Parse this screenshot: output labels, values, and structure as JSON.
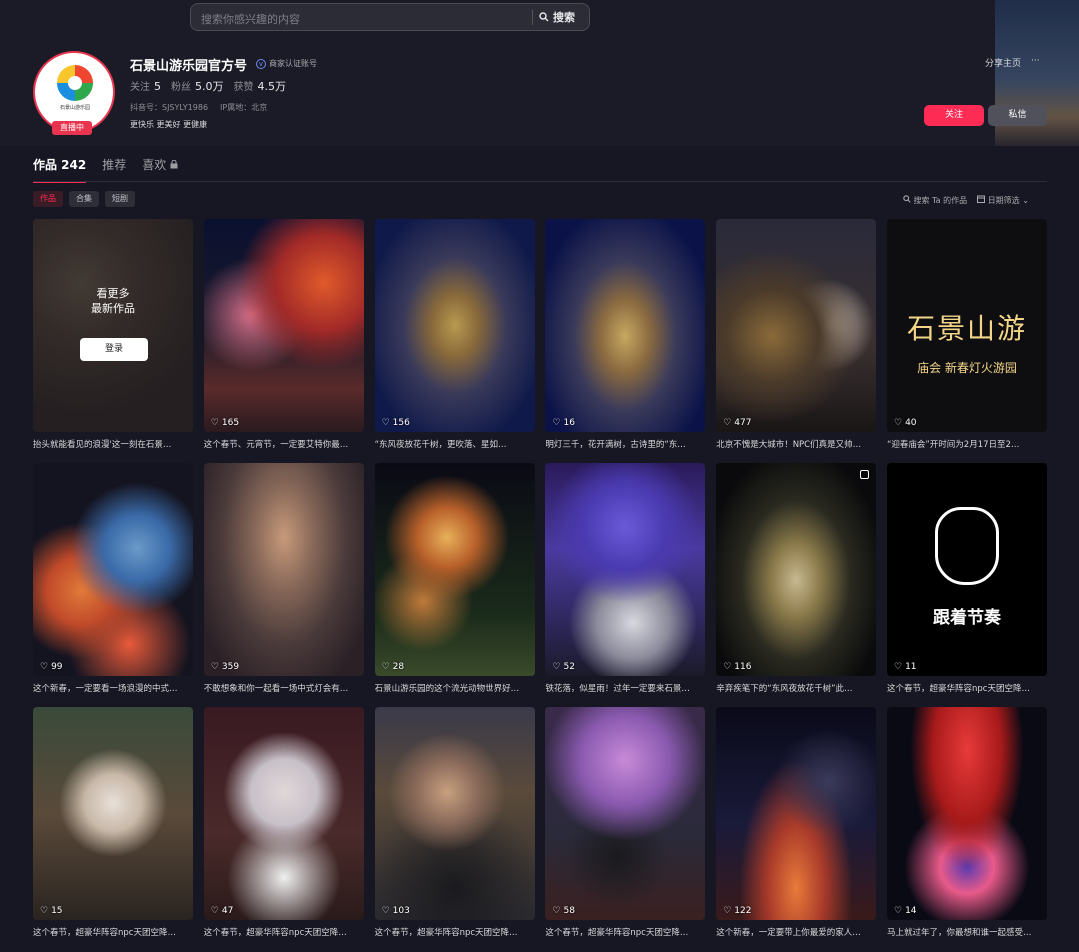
{
  "search": {
    "placeholder": "搜索你感兴趣的内容",
    "button": "搜索"
  },
  "profile": {
    "name": "石景山游乐园官方号",
    "verify_label": "商家认证账号",
    "stats": [
      {
        "label": "关注",
        "value": "5"
      },
      {
        "label": "粉丝",
        "value": "5.0万"
      },
      {
        "label": "获赞",
        "value": "4.5万"
      }
    ],
    "douyin_id": "抖音号：SJSYLY1986",
    "ip_location": "IP属地：北京",
    "bio": "更快乐 更美好 更健康",
    "avatar_text": "石景山游乐园",
    "live_badge": "直播中"
  },
  "actions": {
    "share": "分享主页",
    "more": "···",
    "follow": "关注",
    "message": "私信"
  },
  "tabs": [
    {
      "label": "作品 242",
      "active": true
    },
    {
      "label": "推荐",
      "active": false
    },
    {
      "label": "喜欢",
      "active": false
    }
  ],
  "chips": [
    {
      "label": "作品",
      "active": true
    },
    {
      "label": "合集",
      "active": false
    },
    {
      "label": "短剧",
      "active": false
    }
  ],
  "tools": {
    "search_in": "搜索 Ta 的作品",
    "date_filter": "日期筛选"
  },
  "login_overlay": {
    "line1": "看更多",
    "line2": "最新作品",
    "button": "登录"
  },
  "videos": [
    {
      "likes": "",
      "caption": "抬头就能看见的浪漫'这一刻在石景…"
    },
    {
      "likes": "165",
      "caption": "这个春节、元宵节，一定要艾特你最…"
    },
    {
      "likes": "156",
      "caption": "“东风夜放花千树，更吹落、星如…"
    },
    {
      "likes": "16",
      "caption": "明灯三千，花开满树，古诗里的“东…"
    },
    {
      "likes": "477",
      "caption": "北京不愧是大城市！NPC们真是又帅…"
    },
    {
      "likes": "40",
      "caption": "“迎春庙会”开时间为2月17日至2…"
    },
    {
      "likes": "99",
      "caption": "这个新春，一定要看一场浪漫的中式…"
    },
    {
      "likes": "359",
      "caption": "不敢想象和你一起看一场中式灯会有…"
    },
    {
      "likes": "28",
      "caption": "石景山游乐园的这个流光动物世界好…"
    },
    {
      "likes": "52",
      "caption": "铁花落，似星雨！过年一定要来石景…"
    },
    {
      "likes": "116",
      "caption": "辛弃疾笔下的“东风夜放花千树”此…"
    },
    {
      "likes": "11",
      "caption": "这个春节，超豪华阵容npc天团空降…"
    },
    {
      "likes": "15",
      "caption": "这个春节，超豪华阵容npc天团空降…"
    },
    {
      "likes": "47",
      "caption": "这个春节，超豪华阵容npc天团空降…"
    },
    {
      "likes": "103",
      "caption": "这个春节，超豪华阵容npc天团空降…"
    },
    {
      "likes": "58",
      "caption": "这个春节，超豪华阵容npc天团空降…"
    },
    {
      "likes": "122",
      "caption": "这个新春，一定要带上你最爱的家人…"
    },
    {
      "likes": "14",
      "caption": "马上就过年了，你最想和谁一起感受…"
    }
  ],
  "thumb_texts": {
    "title_big": "石景山游",
    "title_sub": "庙会  新春灯火游园",
    "rhythm": "跟着节奏"
  },
  "colors": {
    "accent": "#fe2c55",
    "background": "#161722"
  }
}
